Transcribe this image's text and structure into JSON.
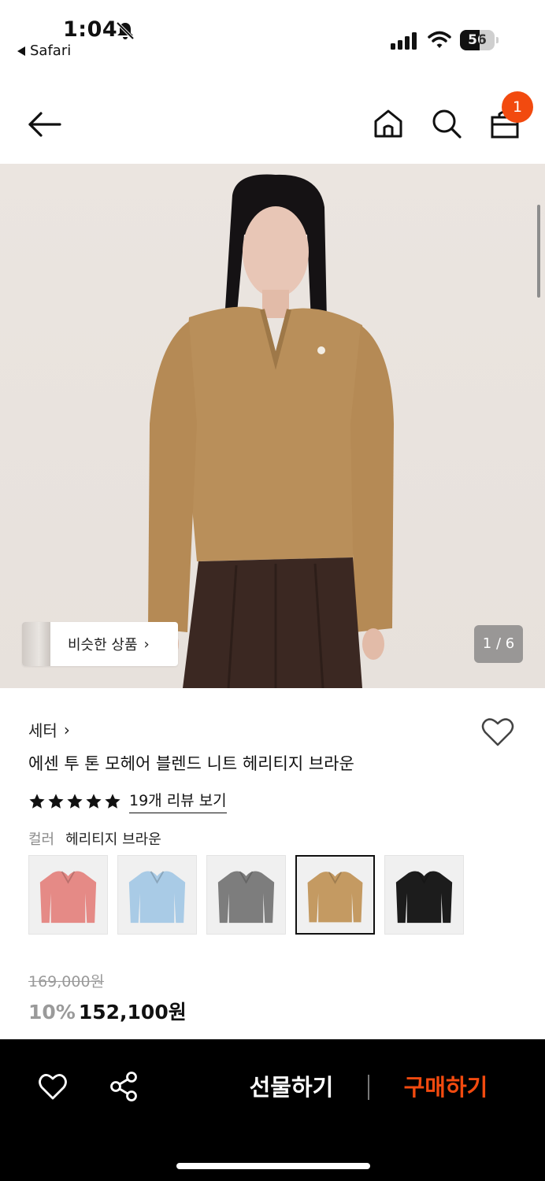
{
  "status_bar": {
    "time": "1:04",
    "back_app": "Safari",
    "battery": "56",
    "battery_level": 0.56,
    "icons": [
      "bell-slash-icon",
      "signal-icon",
      "wifi-icon",
      "battery-icon"
    ]
  },
  "nav": {
    "cart_badge": "1",
    "icons": [
      "back-arrow-icon",
      "home-icon",
      "search-icon",
      "cart-icon"
    ]
  },
  "gallery": {
    "similar_label": "비슷한 상품",
    "page_counter": "1 / 6"
  },
  "product": {
    "category": "세터",
    "title": "에센 투 톤 모헤어 블렌드 니트 헤리티지 브라운",
    "rating": 5,
    "review_link": "19개 리뷰 보기",
    "color_label": "컬러",
    "color_value": "헤리티지 브라운",
    "swatches": [
      {
        "color": "#e58a86",
        "selected": false
      },
      {
        "color": "#a9cbe6",
        "selected": false
      },
      {
        "color": "#7d7d7d",
        "selected": false
      },
      {
        "color": "#c49a62",
        "selected": true
      },
      {
        "color": "#1c1c1c",
        "selected": false
      }
    ],
    "original_price": "169,000원",
    "discount": "10%",
    "sale_price": "152,100원"
  },
  "bottom_bar": {
    "gift_label": "선물하기",
    "buy_label": "구매하기",
    "accent": "#f24a0f"
  }
}
